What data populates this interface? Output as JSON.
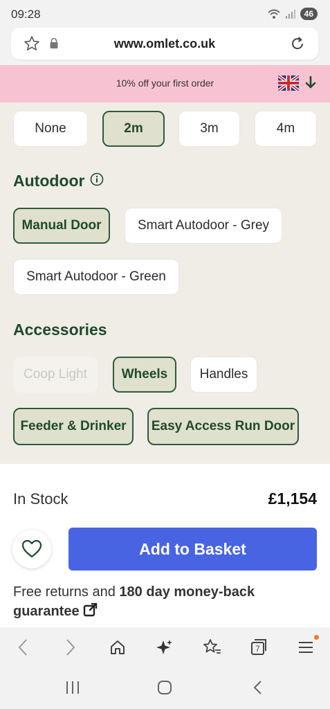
{
  "status_bar": {
    "time": "09:28",
    "battery": "46"
  },
  "url_bar": {
    "url": "www.omlet.co.uk"
  },
  "promo": {
    "text": "10% off your first order"
  },
  "run_length": {
    "options": [
      {
        "label": "None",
        "selected": false
      },
      {
        "label": "2m",
        "selected": true
      },
      {
        "label": "3m",
        "selected": false
      },
      {
        "label": "4m",
        "selected": false
      }
    ]
  },
  "autodoor": {
    "title": "Autodoor",
    "options": [
      {
        "label": "Manual Door",
        "selected": true
      },
      {
        "label": "Smart Autodoor - Grey",
        "selected": false
      },
      {
        "label": "Smart Autodoor - Green",
        "selected": false
      }
    ]
  },
  "accessories": {
    "title": "Accessories",
    "options": [
      {
        "label": "Coop Light",
        "selected": false,
        "disabled": true
      },
      {
        "label": "Wheels",
        "selected": true
      },
      {
        "label": "Handles",
        "selected": false
      },
      {
        "label": "Feeder & Drinker",
        "selected": true
      },
      {
        "label": "Easy Access Run Door",
        "selected": true
      }
    ]
  },
  "product": {
    "stock": "In Stock",
    "price": "£1,154",
    "add_to_basket": "Add to Basket",
    "returns_prefix": "Free returns and ",
    "returns_bold": "180 day money-back guarantee"
  },
  "browser_nav": {
    "tabs_count": "7"
  },
  "colors": {
    "accent_green": "#1f4a2c",
    "basket_blue": "#4864e3",
    "promo_pink": "#f7c3d2"
  }
}
